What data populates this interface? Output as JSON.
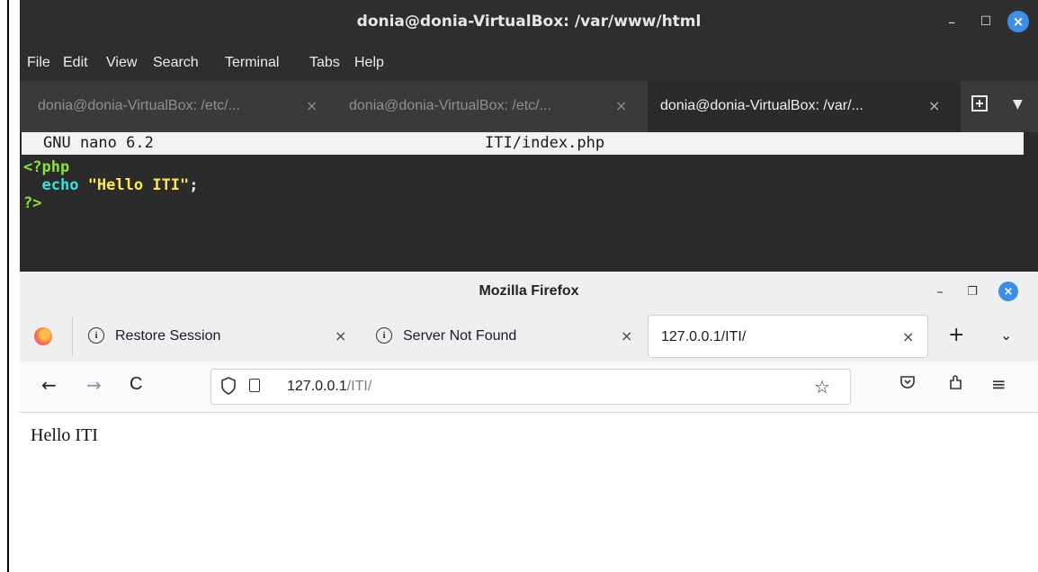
{
  "terminal": {
    "title": "donia@donia-VirtualBox: /var/www/html",
    "window_controls": {
      "minimize": "–",
      "maximize": "☐",
      "close": "×"
    },
    "menu": [
      "File",
      "Edit",
      "View",
      "Search",
      "Terminal",
      "Tabs",
      "Help"
    ],
    "tabs": [
      {
        "label": "donia@donia-VirtualBox: /etc/...",
        "close": "×",
        "active": false
      },
      {
        "label": "donia@donia-VirtualBox: /etc/...",
        "close": "×",
        "active": false
      },
      {
        "label": "donia@donia-VirtualBox: /var/...",
        "close": "×",
        "active": true
      }
    ],
    "new_tab_icon": "new-tab-icon",
    "tab_menu_icon": "dropdown-icon",
    "nano": {
      "version": "GNU nano 6.2",
      "filename": "ITI/index.php",
      "code": {
        "open_tag": "<?php",
        "keyword": "echo",
        "string": "\"Hello ITI\"",
        "semicolon": ";",
        "close_tag": "?>"
      }
    }
  },
  "firefox": {
    "title": "Mozilla Firefox",
    "window_controls": {
      "minimize": "–",
      "restore": "❐",
      "close": "×"
    },
    "tabs": [
      {
        "label": "Restore Session",
        "icon": "info-icon",
        "close": "×",
        "active": false
      },
      {
        "label": "Server Not Found",
        "icon": "info-icon",
        "close": "×",
        "active": false
      },
      {
        "label": "127.0.0.1/ITI/",
        "close": "×",
        "active": true
      }
    ],
    "new_tab": "+",
    "list_tabs": "⌄",
    "nav": {
      "back": "←",
      "forward": "→",
      "reload": "C"
    },
    "url": {
      "host": "127.0.0.1",
      "path": "/ITI/"
    },
    "page_text": "Hello ITI",
    "colors": {
      "accent_close": "#3d8fe6",
      "terminal_bg": "#2b2b2b"
    }
  }
}
